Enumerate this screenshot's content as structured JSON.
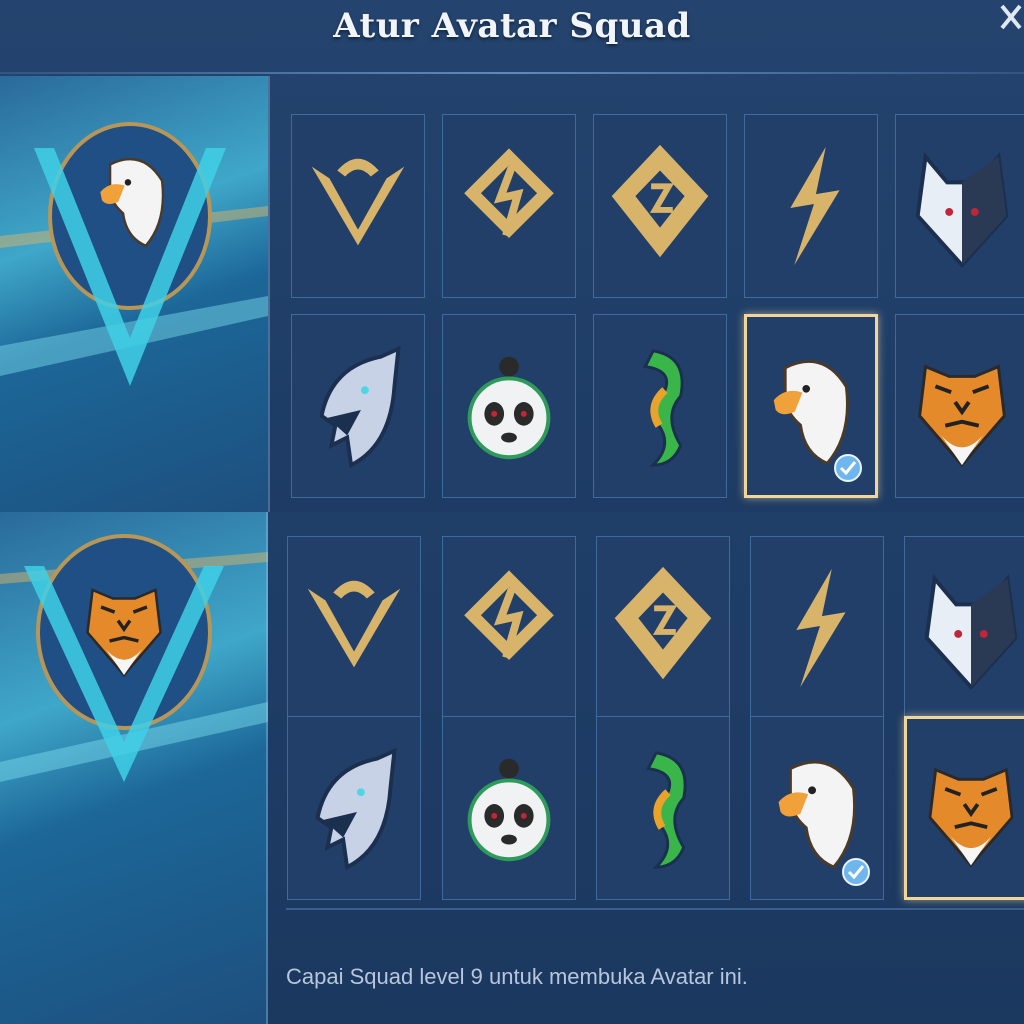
{
  "title": "Atur Avatar Squad",
  "close_icon": "close-icon",
  "avatars": [
    "v-emblem",
    "swirl-emblem",
    "diamond-emblem",
    "lightning-emblem",
    "wolf",
    "shark",
    "panda",
    "dragon",
    "eagle",
    "tiger"
  ],
  "states": [
    {
      "preview": "eagle",
      "selected": "eagle",
      "checked": "eagle"
    },
    {
      "preview": "tiger",
      "selected": "tiger",
      "checked": "eagle"
    }
  ],
  "hint": "Capai Squad level 9 untuk membuka Avatar ini.",
  "colors": {
    "gold": "#d8b46a",
    "frame": "#f2d59a",
    "tile": "#223f6a",
    "check": "#6fb6ef"
  }
}
